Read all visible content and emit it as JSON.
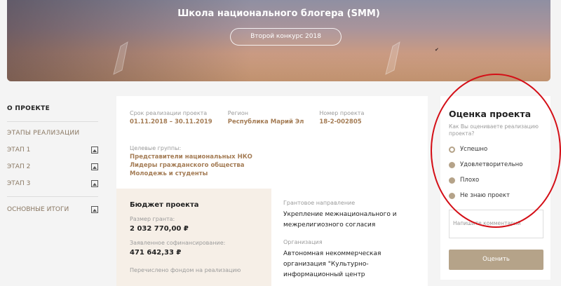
{
  "hero": {
    "title": "Школа национального блогера (SMM)",
    "contest_button": "Второй конкурс 2018"
  },
  "sidebar": {
    "about": "О ПРОЕКТЕ",
    "stages_heading": "ЭТАПЫ РЕАЛИЗАЦИИ",
    "stages": [
      {
        "label": "ЭТАП 1",
        "icon": "image-icon"
      },
      {
        "label": "ЭТАП 2",
        "icon": "image-icon"
      },
      {
        "label": "ЭТАП 3",
        "icon": "image-icon"
      }
    ],
    "results": {
      "label": "ОСНОВНЫЕ ИТОГИ",
      "icon": "image-icon"
    }
  },
  "project": {
    "period_label": "Срок реализации проекта",
    "period_value": "01.11.2018 – 30.11.2019",
    "region_label": "Регион",
    "region_value": "Республика Марий Эл",
    "number_label": "Номер проекта",
    "number_value": "18-2-002805",
    "groups_label": "Целевые группы:",
    "groups": [
      "Представители национальных НКО",
      "Лидеры гражданского общества",
      "Молодежь и студенты"
    ]
  },
  "budget": {
    "title": "Бюджет проекта",
    "grant_label": "Размер гранта:",
    "grant_value": "2 032 770,00 ₽",
    "cofinancing_label": "Заявленное софинансирование:",
    "cofinancing_value": "471 642,33 ₽",
    "transferred_label": "Перечислено фондом на реализацию"
  },
  "details": {
    "direction_label": "Грантовое направление",
    "direction_value": "Укрепление межнационального и межрелигиозного согласия",
    "org_label": "Организация",
    "org_value": "Автономная некоммерческая организация \"Культурно-информационный центр"
  },
  "rating": {
    "title": "Оценка проекта",
    "question": "Как Вы оцениваете реализацию проекта?",
    "options": [
      "Успешно",
      "Удовлетворительно",
      "Плохо",
      "Не знаю проект"
    ],
    "comment_placeholder": "Напишите комментарий",
    "submit_label": "Оценить"
  },
  "colors": {
    "accent": "#a47c55",
    "button": "#b5a389",
    "annotation": "#d40f17"
  }
}
